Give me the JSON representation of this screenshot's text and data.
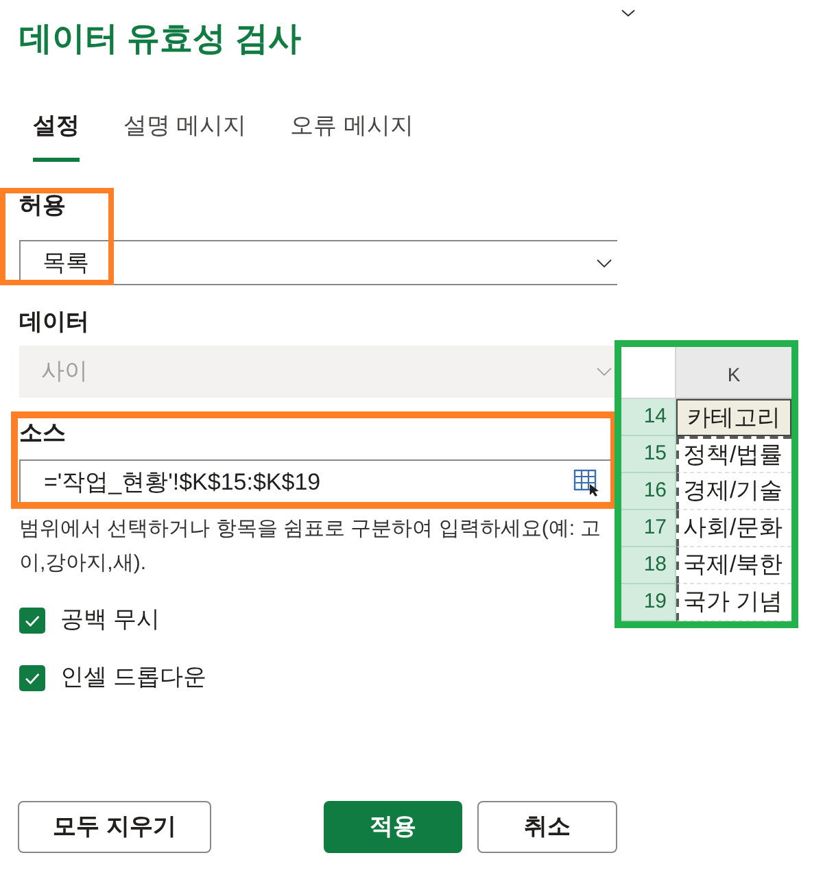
{
  "title": "데이터 유효성 검사",
  "tabs": [
    {
      "label": "설정",
      "selected": true
    },
    {
      "label": "설명 메시지",
      "selected": false
    },
    {
      "label": "오류 메시지",
      "selected": false
    }
  ],
  "allow": {
    "label": "허용",
    "value": "목록",
    "highlighted": true
  },
  "data": {
    "label": "데이터",
    "value": "사이",
    "disabled": true
  },
  "source": {
    "label": "소스",
    "value": "='작업_현황'!$K$15:$K$19",
    "highlighted": true
  },
  "hint_lines": [
    "범위에서 선택하거나 항목을 쉼표로 구분하여 입력하세요(예: 고",
    "이,강아지,새)."
  ],
  "options": [
    {
      "label": "공백 무시",
      "checked": true
    },
    {
      "label": "인셀 드롭다운",
      "checked": true
    }
  ],
  "buttons": [
    {
      "label": "모두 지우기",
      "kind": "secondary"
    },
    {
      "label": "적용",
      "kind": "primary"
    },
    {
      "label": "취소",
      "kind": "secondary"
    }
  ],
  "sheet": {
    "highlighted": true,
    "columns": [
      "K"
    ],
    "rows": [
      {
        "number": "14",
        "cell": "카테고리",
        "kind": "header",
        "in_range": false
      },
      {
        "number": "15",
        "cell": "정책/법률",
        "kind": "item",
        "in_range": true
      },
      {
        "number": "16",
        "cell": "경제/기술",
        "kind": "item",
        "in_range": true
      },
      {
        "number": "17",
        "cell": "사회/문화",
        "kind": "item",
        "in_range": true
      },
      {
        "number": "18",
        "cell": "국제/북한",
        "kind": "item",
        "in_range": true
      },
      {
        "number": "19",
        "cell": "국가 기념",
        "kind": "item",
        "in_range": true
      }
    ]
  }
}
